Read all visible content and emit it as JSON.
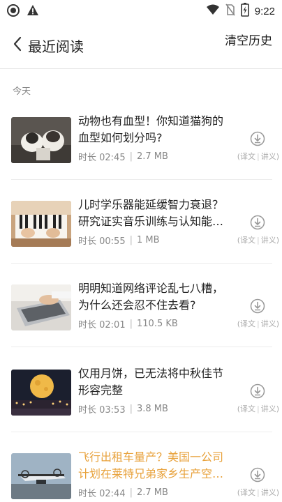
{
  "status_bar": {
    "time": "9:22",
    "icons": [
      "app-circle-icon",
      "warning-icon",
      "wifi-icon",
      "no-sim-icon",
      "battery-charging-icon"
    ]
  },
  "header": {
    "back_icon": "chevron-left-icon",
    "title": "最近阅读",
    "clear_label": "清空历史"
  },
  "section": {
    "label": "今天"
  },
  "items": [
    {
      "title": "动物也有血型！你知道猫狗的血型如何划分吗?",
      "duration_label": "时长 02:45",
      "size": "2.7 MB",
      "tag1": "译文",
      "tag2": "讲义",
      "thumbnail": "cat-and-dog-photo"
    },
    {
      "title": "儿时学乐器能延缓智力衰退？研究证实音乐训练与认知能力间...",
      "duration_label": "时长 00:55",
      "size": "1 MB",
      "tag1": "译文",
      "tag2": "讲义",
      "thumbnail": "piano-keys-photo"
    },
    {
      "title": "明明知道网络评论乱七八糟，为什么还会忍不住去看?",
      "duration_label": "时长 02:01",
      "size": "110.5 KB",
      "tag1": "译文",
      "tag2": "讲义",
      "thumbnail": "laptop-typing-photo"
    },
    {
      "title": "仅用月饼，已无法将中秋佳节形容完整",
      "duration_label": "时长 03:53",
      "size": "3.8 MB",
      "tag1": "译文",
      "tag2": "讲义",
      "thumbnail": "full-moon-photo"
    },
    {
      "title": "飞行出租车量产？美国一公司计划在莱特兄弟家乡生产空中出...",
      "duration_label": "时长 02:44",
      "size": "2.7 MB",
      "tag1": "译文",
      "tag2": "讲义",
      "thumbnail": "flying-taxi-photo"
    }
  ],
  "colors": {
    "accent_orange": "#e8a23c",
    "text": "#222222",
    "muted": "#888888",
    "separator": "#ececec"
  }
}
